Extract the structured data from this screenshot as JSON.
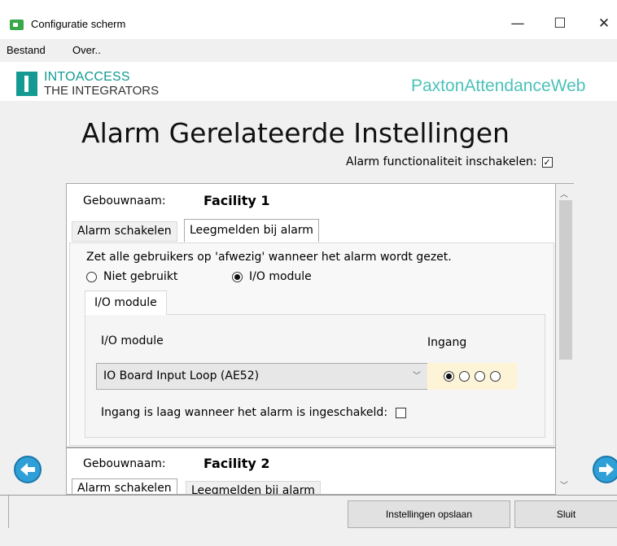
{
  "window": {
    "title": "Configuratie scherm",
    "minimize": "—",
    "maximize": "☐",
    "close": "✕"
  },
  "menu": {
    "items": [
      {
        "label": "Bestand"
      },
      {
        "label": "Over.."
      }
    ]
  },
  "header": {
    "logo_line1": "INTOACCESS",
    "logo_line2": "THE INTEGRATORS",
    "app_name": "PaxtonAttendanceWeb"
  },
  "main": {
    "title": "Alarm Gerelateerde Instellingen",
    "enable_alarm_label": "Alarm functionaliteit inschakelen:",
    "enable_alarm_checked": true
  },
  "facilities": [
    {
      "label": "Gebouwnaam:",
      "name": "Facility 1",
      "tabs": [
        {
          "label": "Alarm schakelen"
        },
        {
          "label": "Leegmelden bij alarm"
        }
      ],
      "active_tab": 1,
      "description": "Zet alle gebruikers op 'afwezig' wanneer het alarm wordt gezet.",
      "radio_options": [
        {
          "label": "Niet gebruikt",
          "selected": false
        },
        {
          "label": "I/O module",
          "selected": true
        }
      ],
      "subtab": "I/O module",
      "io_module_label": "I/O module",
      "io_module_value": "IO Board Input Loop (AE52)",
      "ingang_label": "Ingang",
      "ingang_selected": 1,
      "ingang_count": 4,
      "low_label": "Ingang is laag wanneer het alarm is ingeschakeld:",
      "low_checked": false
    },
    {
      "label": "Gebouwnaam:",
      "name": "Facility 2",
      "tabs": [
        {
          "label": "Alarm schakelen"
        },
        {
          "label": "Leegmelden bij alarm"
        }
      ]
    }
  ],
  "footer": {
    "save_label": "Instellingen opslaan",
    "close_label": "Sluit"
  },
  "colors": {
    "brand_teal": "#149a93",
    "app_name": "#4bc2b9",
    "nav_blue": "#2f9fd8",
    "ingang_bg": "#fdf3d6"
  },
  "icons": {
    "app": "app-window-icon",
    "prev": "arrow-left-circle-icon",
    "next": "arrow-right-circle-icon"
  }
}
